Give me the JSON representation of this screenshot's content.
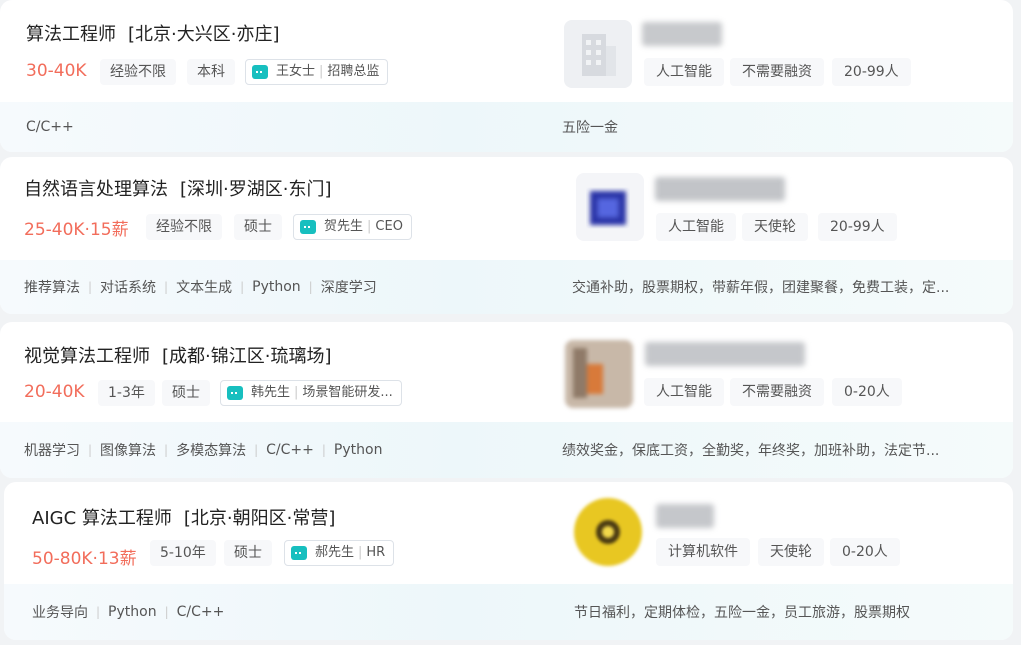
{
  "jobs": [
    {
      "title": "算法工程师",
      "location": "[北京·大兴区·亦庄]",
      "salary": "30-40K",
      "experience": "经验不限",
      "education": "本科",
      "recruiter": "王女士",
      "recruiter_role": "招聘总监",
      "company_tags": [
        "人工智能",
        "不需要融资",
        "20-99人"
      ],
      "skills": [
        "C/C++"
      ],
      "welfare": "五险一金",
      "logo_color": "#dcdfe3",
      "logo_icon": "building-icon"
    },
    {
      "title": "自然语言处理算法",
      "location": "[深圳·罗湖区·东门]",
      "salary": "25-40K·15薪",
      "experience": "经验不限",
      "education": "硕士",
      "recruiter": "贺先生",
      "recruiter_role": "CEO",
      "company_tags": [
        "人工智能",
        "天使轮",
        "20-99人"
      ],
      "skills": [
        "推荐算法",
        "对话系统",
        "文本生成",
        "Python",
        "深度学习"
      ],
      "welfare": "交通补助，股票期权，带薪年假，团建聚餐，免费工装，定...",
      "logo_color": "#2b35a8",
      "logo_icon": "blurred-company-logo"
    },
    {
      "title": "视觉算法工程师",
      "location": "[成都·锦江区·琉璃场]",
      "salary": "20-40K",
      "experience": "1-3年",
      "education": "硕士",
      "recruiter": "韩先生",
      "recruiter_role": "场景智能研发...",
      "company_tags": [
        "人工智能",
        "不需要融资",
        "0-20人"
      ],
      "skills": [
        "机器学习",
        "图像算法",
        "多模态算法",
        "C/C++",
        "Python"
      ],
      "welfare": "绩效奖金，保底工资，全勤奖，年终奖，加班补助，法定节...",
      "logo_color": "#a58a74",
      "logo_icon": "blurred-company-logo"
    },
    {
      "title": "AIGC 算法工程师",
      "location": "[北京·朝阳区·常营]",
      "salary": "50-80K·13薪",
      "experience": "5-10年",
      "education": "硕士",
      "recruiter": "郝先生",
      "recruiter_role": "HR",
      "company_tags": [
        "计算机软件",
        "天使轮",
        "0-20人"
      ],
      "skills": [
        "业务导向",
        "Python",
        "C/C++"
      ],
      "welfare": "节日福利，定期体检，五险一金，员工旅游，股票期权",
      "logo_color": "#e8c722",
      "logo_icon": "blurred-company-logo"
    }
  ],
  "colors": {
    "salary": "#f26d5b",
    "chat_icon": "#17bfbf",
    "tag_bg": "#f7f8fa"
  }
}
